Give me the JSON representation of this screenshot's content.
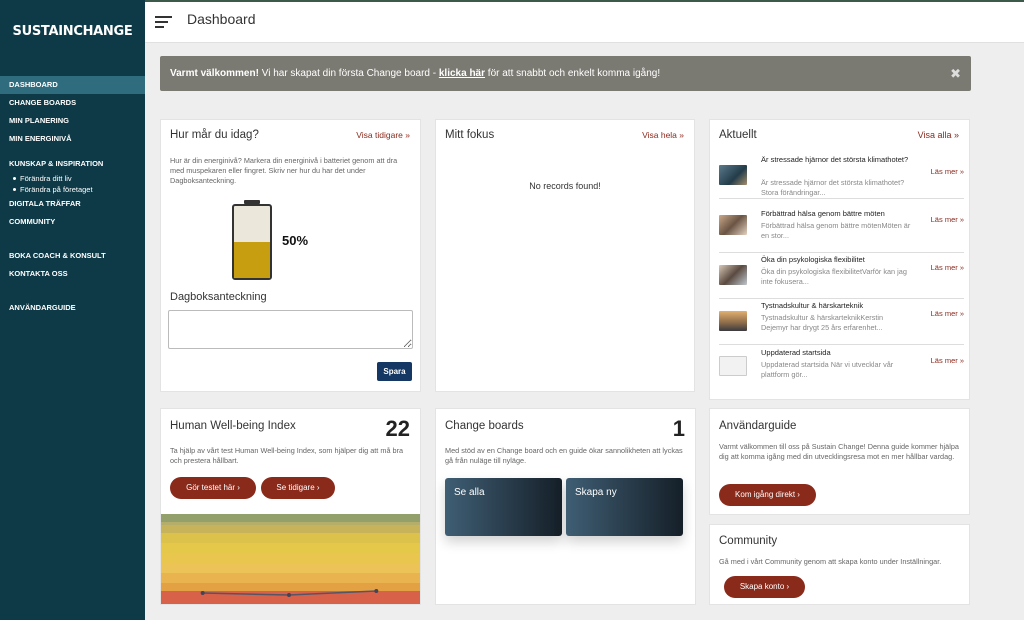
{
  "brand": {
    "logo": "SUSTAINCHANGE"
  },
  "sidebar": {
    "items": [
      {
        "label": "DASHBOARD",
        "active": true
      },
      {
        "label": "CHANGE BOARDS"
      },
      {
        "label": "MIN PLANERING"
      },
      {
        "label": "MIN ENERGINIVÅ"
      },
      {
        "label": "KUNSKAP & INSPIRATION"
      },
      {
        "label": "Förändra ditt liv"
      },
      {
        "label": "Förändra på företaget"
      },
      {
        "label": "DIGITALA TRÄFFAR"
      },
      {
        "label": "COMMUNITY"
      },
      {
        "label": "BOKA COACH & KONSULT"
      },
      {
        "label": "KONTAKTA OSS"
      },
      {
        "label": "ANVÄNDARGUIDE"
      }
    ]
  },
  "header": {
    "title": "Dashboard"
  },
  "banner": {
    "bold": "Varmt välkommen!",
    "text1": " Vi har skapat din första Change board - ",
    "link": "klicka här",
    "text2": " för att snabbt och enkelt komma igång!"
  },
  "mood": {
    "title": "Hur mår du idag?",
    "link": "Visa tidigare »",
    "description": "Hur är din energinivå? Markera din energinivå i batteriet genom att dra med muspekaren eller fingret. Skriv ner hur du har det under Dagboksanteckning.",
    "battery_level": 0.5,
    "battery_label": "50%",
    "diary_label": "Dagboksanteckning",
    "save_label": "Spara"
  },
  "focus": {
    "title": "Mitt fokus",
    "link": "Visa hela »",
    "empty": "No records found!"
  },
  "news": {
    "title": "Aktuellt",
    "link": "Visa alla »",
    "more_label": "Läs mer »",
    "items": [
      {
        "title": "Är stressade hjärnor det största klimathotet?",
        "desc": "Är stressade hjärnor det största klimathotet? Stora förändringar..."
      },
      {
        "title": "Förbättrad hälsa genom bättre möten",
        "desc": "Förbättrad hälsa genom bättre mötenMöten är en stor..."
      },
      {
        "title": "Öka din psykologiska flexibilitet",
        "desc": "Öka din psykologiska flexibilitetVarför kan jag inte fokusera..."
      },
      {
        "title": "Tystnadskultur & härskarteknik",
        "desc": "Tystnadskultur & härskarteknikKerstin Dejemyr har drygt 25 års erfarenhet..."
      },
      {
        "title": "Uppdaterad startsida",
        "desc": "Uppdaterad startsida När vi utvecklar vår plattform gör..."
      }
    ]
  },
  "hwi": {
    "title": "Human Well-being Index",
    "value": "22",
    "description": "Ta hjälp av vårt test Human Well-being Index, som hjälper dig att må bra och prestera hållbart.",
    "btn_test": "Gör testet här ›",
    "btn_prev": "Se tidigare ›"
  },
  "boards": {
    "title": "Change boards",
    "count": "1",
    "description": "Med stöd av en Change board och en guide ökar sannolikheten att lyckas gå från nuläge till nyläge.",
    "tile_all": "Se alla",
    "tile_new": "Skapa ny"
  },
  "guide": {
    "title": "Användarguide",
    "description": "Varmt välkommen till oss på Sustain Change! Denna guide kommer hjälpa dig att komma igång med din utvecklingsresa mot en mer hållbar vardag.",
    "button": "Kom igång direkt ›"
  },
  "community": {
    "title": "Community",
    "description": "Gå med i vårt Community genom att skapa konto under Inställningar.",
    "button": "Skapa konto ›"
  },
  "colors": {
    "sidebar_bg": "#0e3a47",
    "accent_red": "#8a2a1b",
    "battery_fill": "#c79e10",
    "save_button": "#143763"
  }
}
